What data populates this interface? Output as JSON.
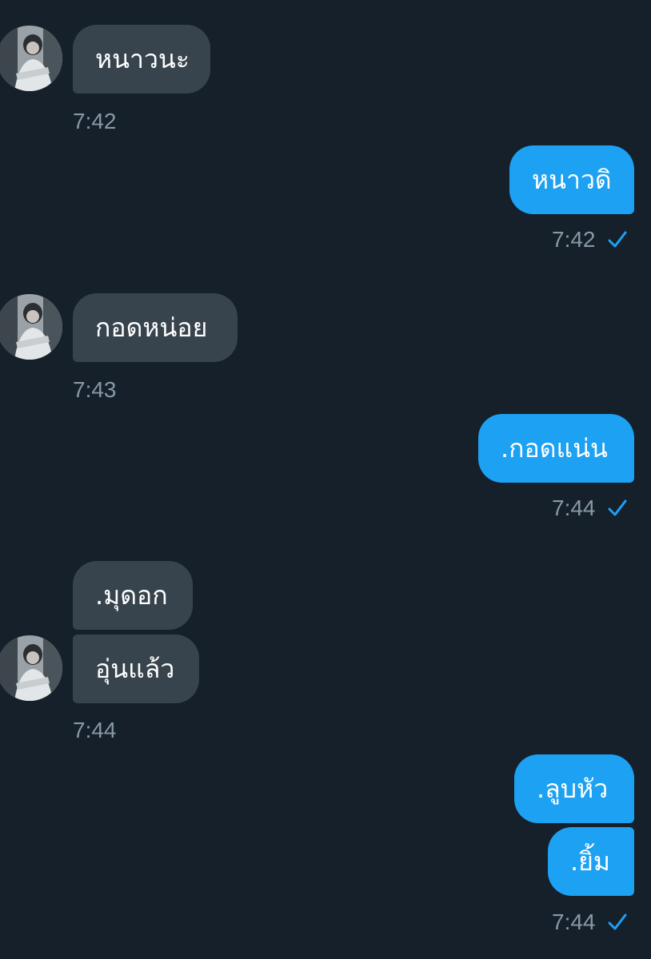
{
  "messages": [
    {
      "side": "in",
      "text": "หนาวนะ",
      "time": "7:42"
    },
    {
      "side": "out",
      "text": "หนาวดิ",
      "time": "7:42"
    },
    {
      "side": "in",
      "text": "กอดหน่อย",
      "time": "7:43"
    },
    {
      "side": "out",
      "text": ".กอดแน่น",
      "time": "7:44"
    },
    {
      "side": "in",
      "text": ".มุดอก"
    },
    {
      "side": "in",
      "text": "อุ่นแล้ว",
      "time": "7:44"
    },
    {
      "side": "out",
      "text": ".ลูบหัว"
    },
    {
      "side": "out",
      "text": ".ยิ้ม",
      "time": "7:44"
    }
  ],
  "colors": {
    "background": "#15202b",
    "incoming_bubble": "#38444d",
    "outgoing_bubble": "#1da1f2",
    "timestamp": "#8899a6",
    "read_check": "#1da1f2"
  },
  "icons": {
    "read_receipt": "check-icon",
    "avatar": "avatar"
  }
}
